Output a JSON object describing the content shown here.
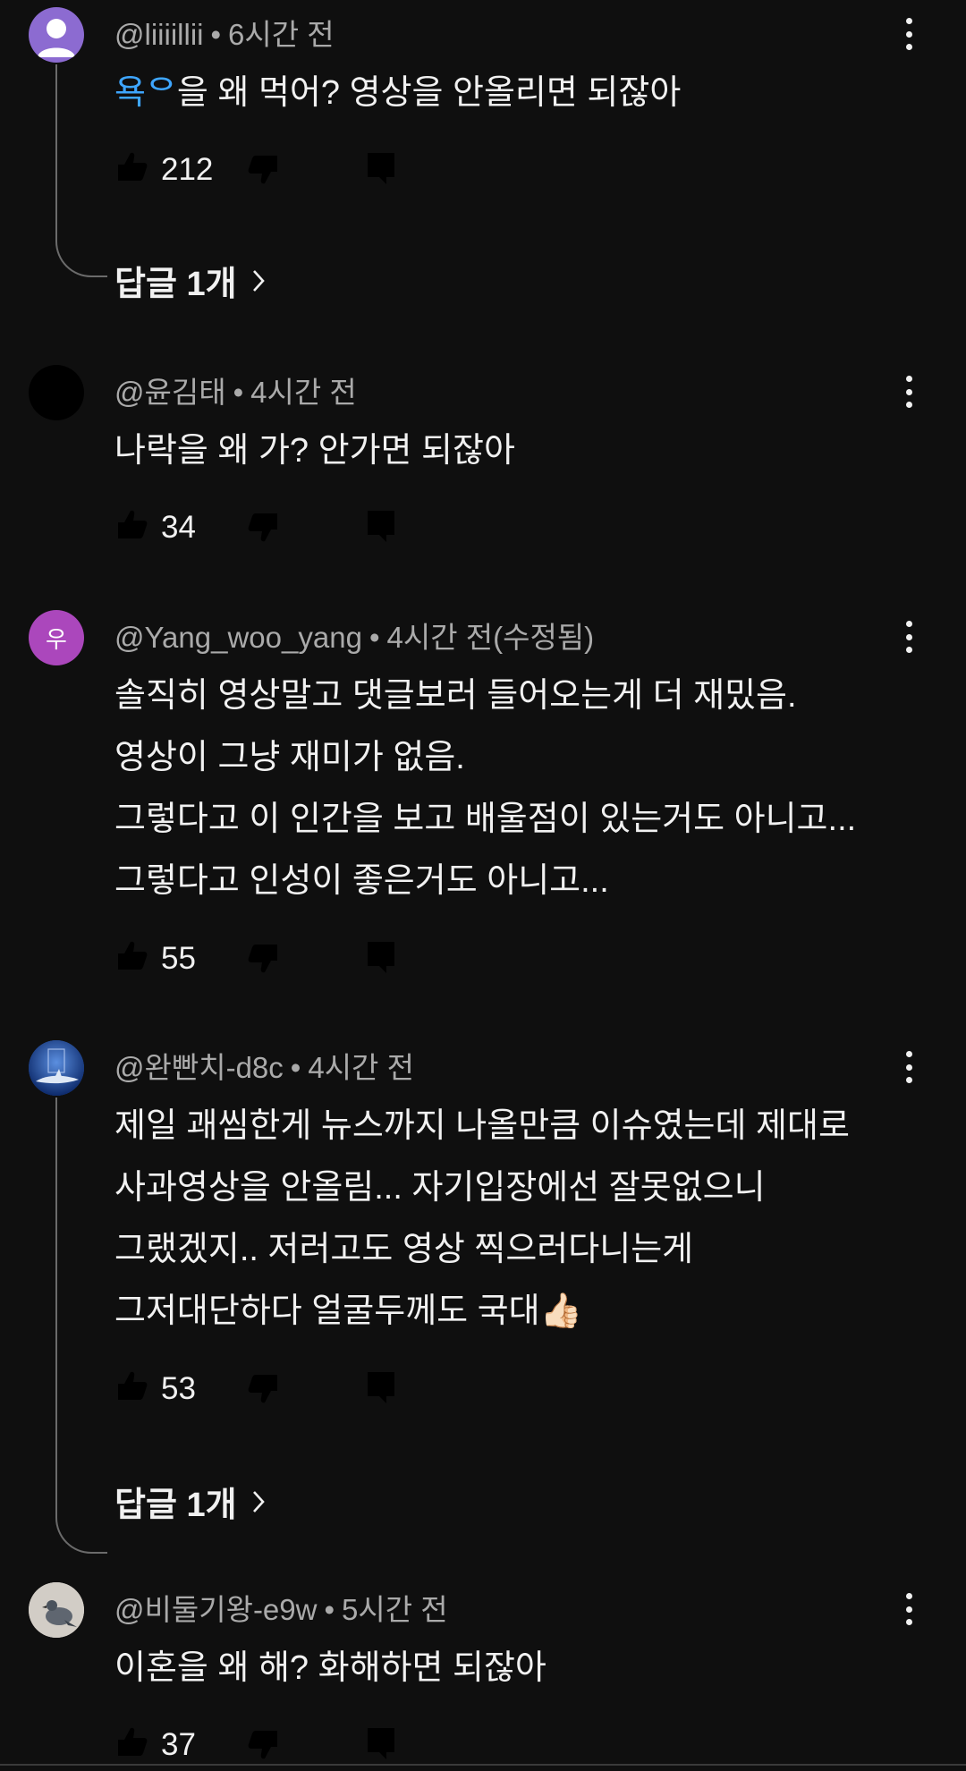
{
  "comments": [
    {
      "author": "@liiiillii",
      "time": "6시간 전",
      "text_parts": [
        "욕ᄋ",
        "을 왜 먹어? 영상을 안올리면 되잖아"
      ],
      "likes": "212",
      "replies_label": "답글 1개",
      "avatar_color": "#8c6bd1",
      "avatar_type": "default-person"
    },
    {
      "author": "@윤김태",
      "time": "4시간 전",
      "lines": [
        "나락을 왜 가? 안가면 되잖아"
      ],
      "likes": "34",
      "avatar_color": "#000000",
      "avatar_type": "solid"
    },
    {
      "author": "@Yang_woo_yang",
      "time": "4시간 전(수정됨)",
      "lines": [
        "솔직히 영상말고 댓글보러 들어오는게 더 재밌음.",
        "영상이 그냥 재미가 없음.",
        "그렇다고 이 인간을 보고 배울점이 있는거도 아니고...",
        "그렇다고 인성이 좋은거도 아니고..."
      ],
      "likes": "55",
      "avatar_color": "#ab47bc",
      "avatar_letter": "우",
      "avatar_type": "letter"
    },
    {
      "author": "@완빤치-d8c",
      "time": "4시간 전",
      "lines": [
        "제일 괘씸한게 뉴스까지 나올만큼 이슈였는데 제대로",
        "사과영상을 안올림... 자기입장에선 잘못없으니",
        "그랬겠지.. 저러고도 영상 찍으러다니는게",
        "그저대단하다 얼굴두께도 국대👍🏻"
      ],
      "likes": "53",
      "replies_label": "답글 1개",
      "avatar_color": "#1f4fa8",
      "avatar_type": "shark-image"
    },
    {
      "author": "@비둘기왕-e9w",
      "time": "5시간 전",
      "lines": [
        "이혼을 왜 해? 화해하면 되잖아"
      ],
      "likes": "37",
      "avatar_color": "#c9c4bd",
      "avatar_type": "pigeon-image"
    }
  ],
  "icons": {
    "like": "thumbs-up-icon",
    "dislike": "thumbs-down-icon",
    "reply": "reply-icon",
    "more": "more-vert-icon",
    "chevron": "chevron-right-icon"
  },
  "colors": {
    "background": "#0f0f0f",
    "text": "#f1f1f1",
    "meta": "#aaaaaa",
    "highlight": "#3ea6ff"
  }
}
